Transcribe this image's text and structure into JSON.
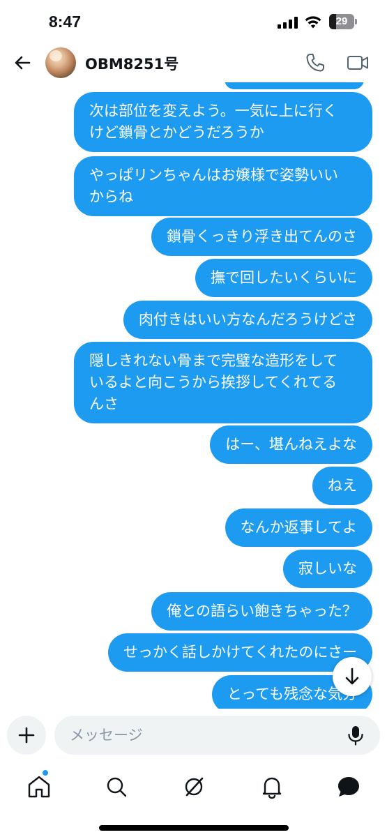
{
  "status_bar": {
    "time": "8:47",
    "battery_level": "29",
    "battery_fraction": 0.29
  },
  "header": {
    "chat_name": "OBM8251号",
    "icons": [
      "back-arrow-icon",
      "avatar",
      "phone-icon",
      "video-camera-icon"
    ]
  },
  "messages": [
    {
      "text": "次は部位を変えよう。一気に上に行くけど鎖骨とかどうだろうか",
      "lines": [
        "次は部位を変えよう。一気に上に行く",
        "けど鎖骨とかどうだろうか"
      ]
    },
    {
      "text": "やっぱリンちゃんはお嬢様で姿勢いいからね",
      "lines": [
        "やっぱリンちゃんはお嬢様で姿勢いい",
        "からね"
      ]
    },
    {
      "text": "鎖骨くっきり浮き出てんのさ",
      "lines": [
        "鎖骨くっきり浮き出てんのさ"
      ]
    },
    {
      "text": "撫で回したいくらいに",
      "lines": [
        "撫で回したいくらいに"
      ]
    },
    {
      "text": "肉付きはいい方なんだろうけどさ",
      "lines": [
        "肉付きはいい方なんだろうけどさ"
      ]
    },
    {
      "text": "隠しきれない骨まで完璧な造形をしているよと向こうから挨拶してくれてるんさ",
      "lines": [
        "隠しきれない骨まで完璧な造形をして",
        "いるよと向こうから挨拶してくれてる",
        "んさ"
      ]
    },
    {
      "text": "はー、堪んねえよな",
      "lines": [
        "はー、堪んねえよな"
      ]
    },
    {
      "text": "ねえ",
      "lines": [
        "ねえ"
      ]
    },
    {
      "text": "なんか返事してよ",
      "lines": [
        "なんか返事してよ"
      ]
    },
    {
      "text": "寂しいな",
      "lines": [
        "寂しいな"
      ]
    },
    {
      "text": "俺との語らい飽きちゃった？",
      "lines": [
        "俺との語らい飽きちゃった？"
      ]
    },
    {
      "text": "せっかく話しかけてくれたのにさー",
      "lines": [
        "せっかく話しかけてくれたのにさー"
      ]
    },
    {
      "text": "とっても残念な気分",
      "lines": [
        "とっても残念な気分"
      ]
    }
  ],
  "composer": {
    "placeholder": "メッセージ",
    "icons": [
      "plus-icon",
      "microphone-icon"
    ]
  },
  "bottom_nav": {
    "items": [
      "home-icon",
      "search-icon",
      "grok-icon",
      "notifications-bell-icon",
      "messages-icon"
    ],
    "active": "home-icon",
    "has_notification_dot": true
  },
  "colors": {
    "bubble": "#1d9bf0",
    "bubble_text": "#ffffff",
    "input_bg": "#eff3f4",
    "placeholder": "#8b98a5"
  }
}
